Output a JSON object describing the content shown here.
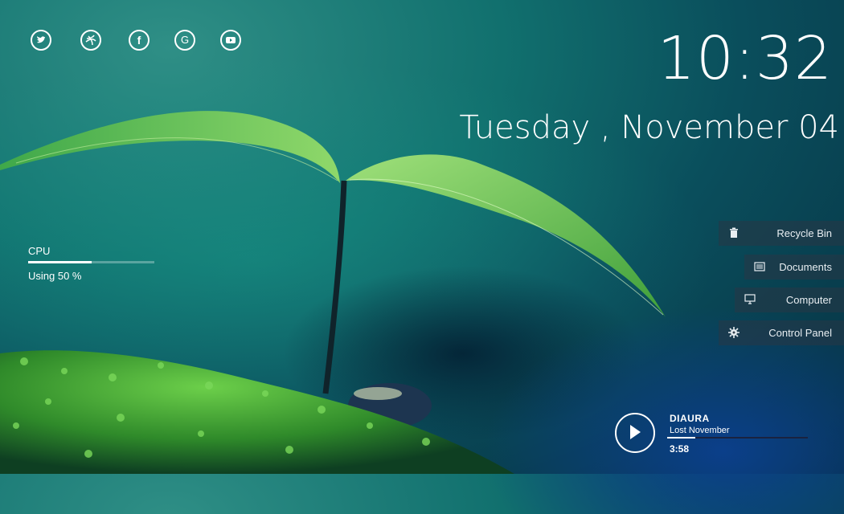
{
  "social": [
    "twitter-icon",
    "dribbble-icon",
    "facebook-icon",
    "google-icon",
    "youtube-icon"
  ],
  "clock": {
    "time": "10:32",
    "date": "Tuesday , November 04"
  },
  "cpu": {
    "label": "CPU",
    "usage_text": "Using 50 %",
    "usage_fraction": 0.5
  },
  "shortcuts": [
    {
      "label": "Recycle Bin",
      "icon": "trash-icon"
    },
    {
      "label": "Documents",
      "icon": "document-icon"
    },
    {
      "label": "Computer",
      "icon": "monitor-icon"
    },
    {
      "label": "Control Panel",
      "icon": "gear-icon"
    }
  ],
  "player": {
    "artist": "DIAURA",
    "song": "Lost November",
    "time": "3:58",
    "progress_fraction": 0.2
  },
  "colors": {
    "accent": "#ffffff",
    "panel": "#28374680"
  }
}
